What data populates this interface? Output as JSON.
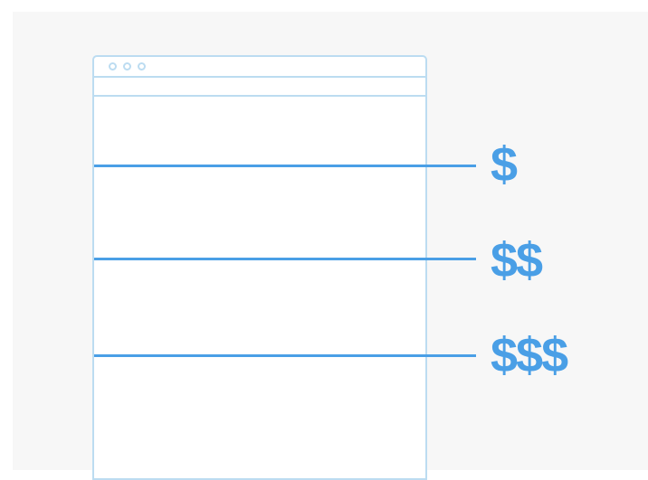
{
  "colors": {
    "browser_outline": "#bcdcf1",
    "accent": "#4a9fe6",
    "background": "#f7f7f7"
  },
  "window_controls": [
    "dot",
    "dot",
    "dot"
  ],
  "tiers": [
    {
      "label": "$"
    },
    {
      "label": "$$"
    },
    {
      "label": "$$$"
    }
  ]
}
